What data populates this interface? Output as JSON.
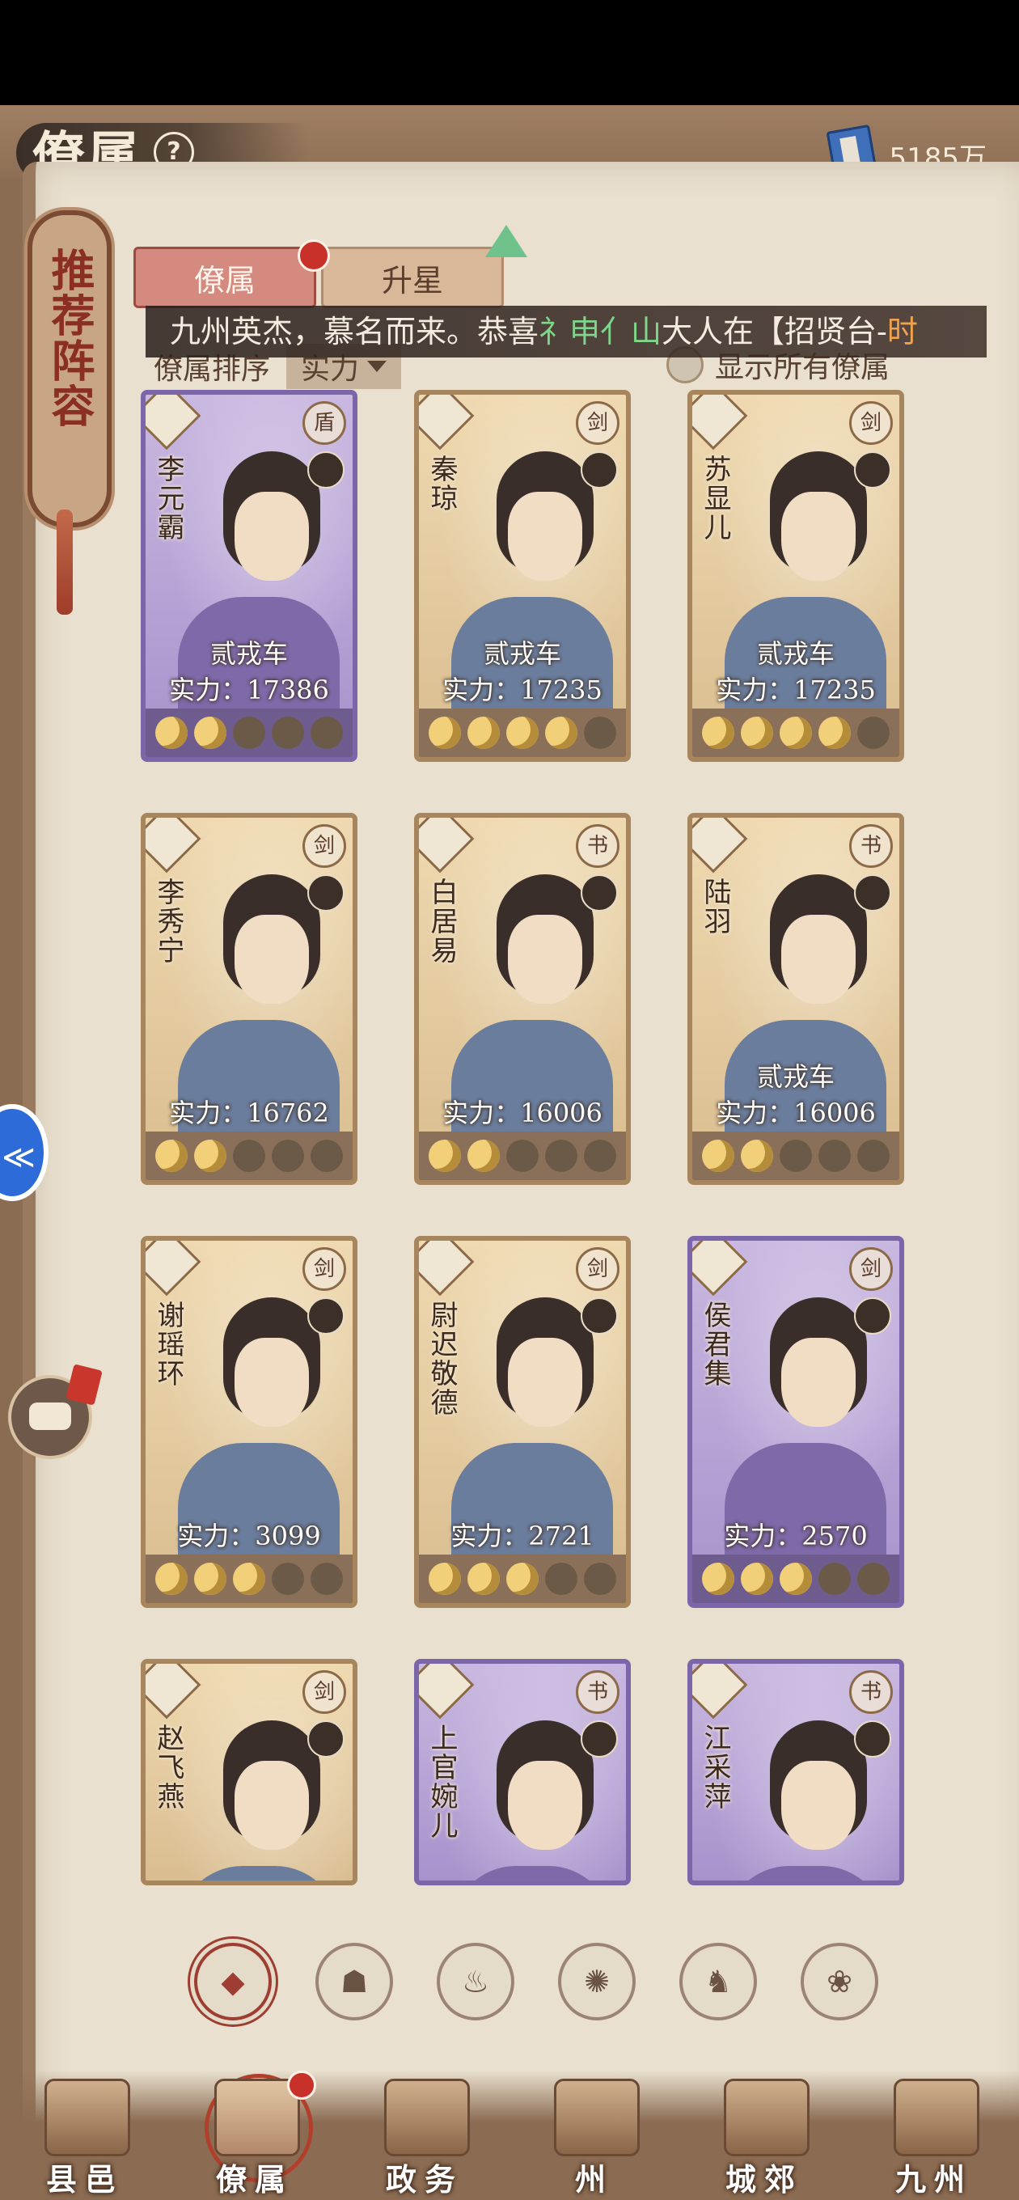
{
  "header": {
    "title": "僚属",
    "help": "?",
    "currency_value": "5185万"
  },
  "side_plaque": {
    "text": "推荐阵容"
  },
  "tabs": [
    {
      "label": "僚属",
      "active": true,
      "badge": true
    },
    {
      "label": "升星",
      "active": false,
      "badge": false
    }
  ],
  "marquee": {
    "prefix": "九州英杰，慕名而来。恭喜",
    "player": "礻申亻山",
    "middle": "大人在【招贤台-",
    "tail": "时"
  },
  "sort": {
    "label": "僚属排序",
    "value": "实力"
  },
  "show_all_label": "显示所有僚属",
  "cards": [
    {
      "name": "李元霸",
      "rank": "贰戎车",
      "power": "实力：17386",
      "moons": 2,
      "weapon": "盾",
      "style": "purple"
    },
    {
      "name": "秦琼",
      "rank": "贰戎车",
      "power": "实力：17235",
      "moons": 4,
      "weapon": "剑",
      "style": "gold"
    },
    {
      "name": "苏显儿",
      "rank": "贰戎车",
      "power": "实力：17235",
      "moons": 4,
      "weapon": "剑",
      "style": "gold"
    },
    {
      "name": "李秀宁",
      "rank": "",
      "power": "实力：16762",
      "moons": 2,
      "weapon": "剑",
      "style": "gold"
    },
    {
      "name": "白居易",
      "rank": "",
      "power": "实力：16006",
      "moons": 2,
      "weapon": "书",
      "style": "gold"
    },
    {
      "name": "陆羽",
      "rank": "贰戎车",
      "power": "实力：16006",
      "moons": 2,
      "weapon": "书",
      "style": "gold"
    },
    {
      "name": "谢瑶环",
      "rank": "",
      "power": "实力：3099",
      "moons": 3,
      "weapon": "剑",
      "style": "gold"
    },
    {
      "name": "尉迟敬德",
      "rank": "",
      "power": "实力：2721",
      "moons": 3,
      "weapon": "剑",
      "style": "gold"
    },
    {
      "name": "侯君集",
      "rank": "",
      "power": "实力：2570",
      "moons": 3,
      "weapon": "剑",
      "style": "purple"
    },
    {
      "name": "赵飞燕",
      "rank": "",
      "power": "",
      "moons": 0,
      "weapon": "剑",
      "style": "gold"
    },
    {
      "name": "上官婉儿",
      "rank": "",
      "power": "",
      "moons": 0,
      "weapon": "书",
      "style": "purple"
    },
    {
      "name": "江采萍",
      "rank": "",
      "power": "",
      "moons": 0,
      "weapon": "书",
      "style": "purple"
    }
  ],
  "filters": [
    {
      "icon": "all-icon",
      "glyph": "◆",
      "active": true
    },
    {
      "icon": "military-icon",
      "glyph": "☗",
      "active": false
    },
    {
      "icon": "gourd-icon",
      "glyph": "♨",
      "active": false
    },
    {
      "icon": "fan-icon",
      "glyph": "✺",
      "active": false
    },
    {
      "icon": "horse-icon",
      "glyph": "♞",
      "active": false
    },
    {
      "icon": "lotus-icon",
      "glyph": "❀",
      "active": false
    }
  ],
  "nav": [
    {
      "label": "县邑",
      "active": false
    },
    {
      "label": "僚属",
      "active": true
    },
    {
      "label": "政务",
      "active": false
    },
    {
      "label": "州",
      "active": false
    },
    {
      "label": "城郊",
      "active": false
    },
    {
      "label": "九州",
      "active": false
    }
  ],
  "colors": {
    "accent_red": "#c7312a",
    "paper": "#e9e0cf",
    "highlight_green": "#7fd68a",
    "highlight_orange": "#f0a24c"
  }
}
